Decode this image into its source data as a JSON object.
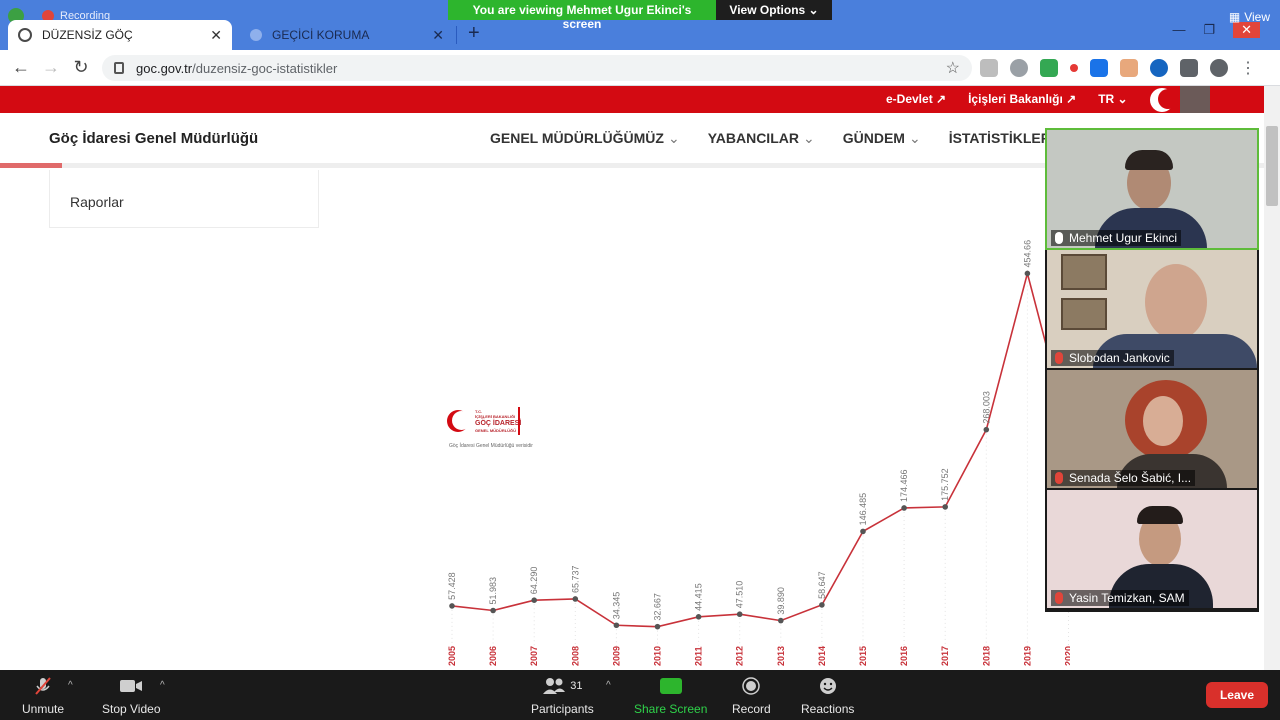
{
  "zoom": {
    "banner": {
      "viewing": "You are viewing Mehmet Ugur Ekinci's screen",
      "view_options": "View Options"
    },
    "recording": "Recording",
    "view_corner": "View",
    "controls": {
      "unmute": "Unmute",
      "stop_video": "Stop Video",
      "participants": "Participants",
      "participants_count": "31",
      "share_screen": "Share Screen",
      "record": "Record",
      "reactions": "Reactions",
      "leave": "Leave"
    },
    "participants": [
      {
        "name": "Mehmet Ugur Ekinci",
        "muted": false,
        "active": true
      },
      {
        "name": "Slobodan Jankovic",
        "muted": true,
        "active": false
      },
      {
        "name": "Senada Šelo Šabić, I...",
        "muted": true,
        "active": false
      },
      {
        "name": "Yasin Temizkan, SAM",
        "muted": true,
        "active": false
      }
    ]
  },
  "browser": {
    "tabs": [
      {
        "title": "DÜZENSİZ GÖÇ",
        "active": true
      },
      {
        "title": "GEÇİCİ KORUMA",
        "active": false
      }
    ],
    "url_host": "goc.gov.tr",
    "url_path": "/duzensiz-goc-istatistikler"
  },
  "site": {
    "top_links": [
      "e-Devlet",
      "İçişleri Bakanlığı",
      "TR"
    ],
    "brand": "Göç İdaresi Genel Müdürlüğü",
    "menu": [
      "GENEL MÜDÜRLÜĞÜMÜZ",
      "YABANCILAR",
      "GÜNDEM",
      "İSTATİSTİKLER"
    ],
    "sidebar_item": "Raporlar",
    "watermark": {
      "line1": "T.C.",
      "line2": "İÇİŞLERİ BAKANLIĞI",
      "line3": "GÖÇ İDARESİ",
      "line4": "GENEL MÜDÜRLÜĞÜ",
      "sub": "Göç İdaresi Genel Müdürlüğü verisidir"
    }
  },
  "chart_data": {
    "type": "line",
    "x": [
      "2005",
      "2006",
      "2007",
      "2008",
      "2009",
      "2010",
      "2011",
      "2012",
      "2013",
      "2014",
      "2015",
      "2016",
      "2017",
      "2018",
      "2019",
      "2020"
    ],
    "y": [
      57428,
      51983,
      64290,
      65737,
      34345,
      32667,
      44415,
      47510,
      39890,
      58647,
      146485,
      174466,
      175752,
      268003,
      454662,
      null
    ],
    "labels": [
      "57.428",
      "51.983",
      "64.290",
      "65.737",
      "34.345",
      "32.667",
      "44.415",
      "47.510",
      "39.890",
      "58.647",
      "146.485",
      "174.466",
      "175.752",
      "268.003",
      "454.66",
      ""
    ],
    "ylim": [
      0,
      500000
    ],
    "grid": false,
    "series_color": "#c8323a"
  }
}
